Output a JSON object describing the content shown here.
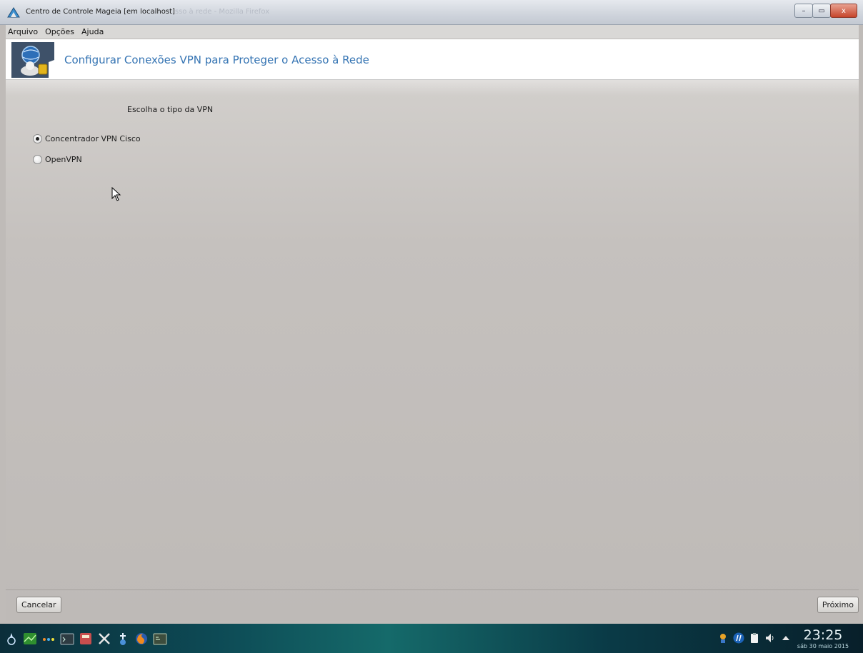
{
  "window": {
    "title": "Centro de Controle Mageia  [em localhost]",
    "title_ghost": "sso à rede - Mozilla Firefox",
    "buttons": {
      "minimize": "–",
      "maximize": "▭",
      "close": "x"
    }
  },
  "menubar": {
    "items": [
      "Arquivo",
      "Opções",
      "Ajuda"
    ]
  },
  "banner": {
    "title": "Configurar Conexões VPN para Proteger o Acesso à Rede"
  },
  "content": {
    "prompt": "Escolha o tipo da VPN",
    "options": [
      {
        "label": "Concentrador VPN Cisco",
        "checked": true
      },
      {
        "label": "OpenVPN",
        "checked": false
      }
    ]
  },
  "footer": {
    "cancel": "Cancelar",
    "next": "Próximo"
  },
  "taskbar": {
    "launchers": [
      "mageia-menu-icon",
      "desktop-icon",
      "dots-icon",
      "terminal-icon",
      "calculator-icon",
      "tools-icon",
      "mageia-control-icon",
      "firefox-icon",
      "console-icon"
    ],
    "tray": [
      "network-icon",
      "hp-icon",
      "clipboard-icon",
      "volume-icon",
      "arrow-up-icon"
    ],
    "time": "23:25",
    "date": "sáb 30 maio 2015"
  },
  "colors": {
    "accent": "#3574b3",
    "background": "#bfbbb8"
  }
}
